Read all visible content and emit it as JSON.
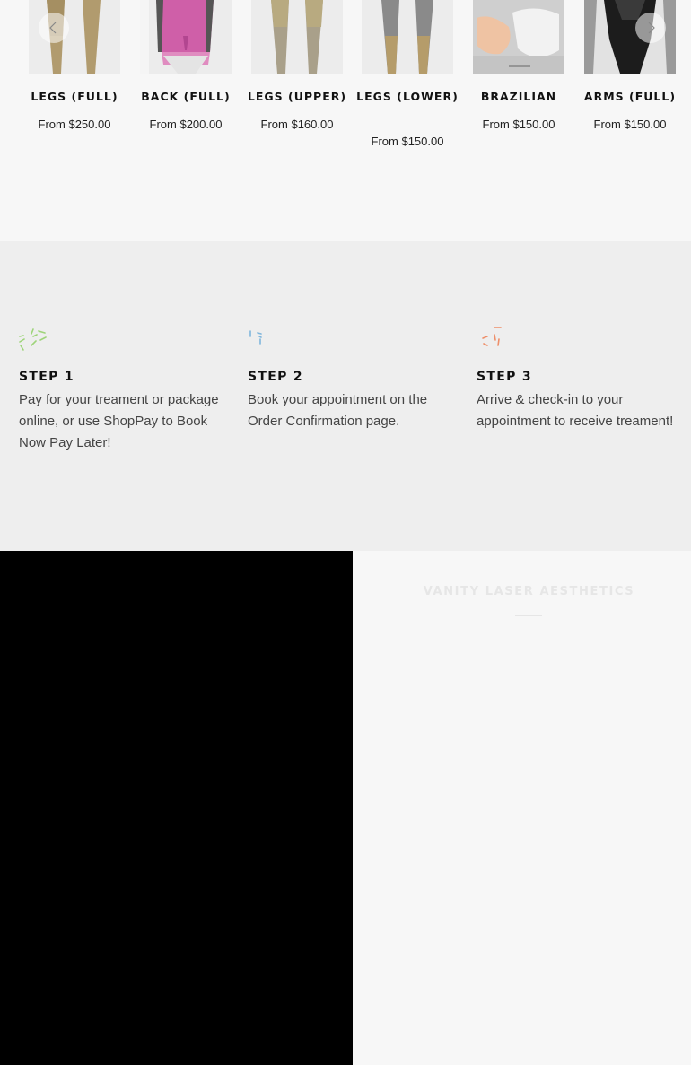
{
  "products": [
    {
      "title": "LEGS (FULL)",
      "price": "From $250.00",
      "image": "legs-full-image"
    },
    {
      "title": "BACK (FULL)",
      "price": "From $200.00",
      "image": "back-full-image"
    },
    {
      "title": "LEGS (UPPER)",
      "price": "From $160.00",
      "image": "legs-upper-image"
    },
    {
      "title": "LEGS (LOWER)",
      "price": "From $150.00",
      "image": "legs-lower-image"
    },
    {
      "title": "BRAZILIAN",
      "price": "From $150.00",
      "image": "brazilian-image"
    },
    {
      "title": "ARMS (FULL)",
      "price": "From $150.00",
      "image": "arms-full-image"
    }
  ],
  "carousel": {
    "prev_icon": "chevron-left-icon",
    "next_icon": "chevron-right-icon"
  },
  "steps": [
    {
      "title": "STEP 1",
      "text": "Pay for your treament or package online, or use ShopPay to Book Now Pay Later!",
      "icon": "sparkle-icon",
      "color": "#9ed47a"
    },
    {
      "title": "STEP 2",
      "text": "Book your appointment on the Order Confirmation page.",
      "icon": "sparkle-icon",
      "color": "#7fb6dc"
    },
    {
      "title": "STEP 3",
      "text": "Arrive & check-in to your appointment to receive treament!",
      "icon": "sparkle-icon",
      "color": "#ee8f6a"
    }
  ],
  "brand": {
    "title": "VANITY LASER AESTHETICS"
  },
  "colors": {
    "page_bg": "#f7f7f7",
    "steps_bg": "#eeeeee",
    "video_bg": "#000000"
  }
}
